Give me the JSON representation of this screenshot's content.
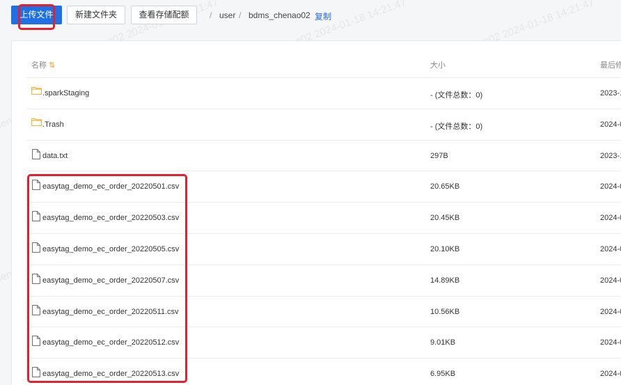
{
  "toolbar": {
    "upload_label": "上传文件",
    "new_folder_label": "新建文件夹",
    "quota_label": "查看存储配额"
  },
  "breadcrumb": {
    "sep": "/",
    "items": [
      "user",
      "bdms_chenao02"
    ],
    "copy_label": "复制"
  },
  "table": {
    "headers": {
      "name": "名称",
      "size": "大小",
      "modified": "最后修"
    },
    "rows": [
      {
        "type": "folder",
        "name": ".sparkStaging",
        "size": "- (文件总数：0)",
        "date": "2023-1"
      },
      {
        "type": "folder",
        "name": ".Trash",
        "size": "- (文件总数：0)",
        "date": "2024-0"
      },
      {
        "type": "file",
        "name": "data.txt",
        "size": "297B",
        "date": "2023-1"
      },
      {
        "type": "file",
        "name": "easytag_demo_ec_order_20220501.csv",
        "size": "20.65KB",
        "date": "2024-0"
      },
      {
        "type": "file",
        "name": "easytag_demo_ec_order_20220503.csv",
        "size": "20.45KB",
        "date": "2024-0"
      },
      {
        "type": "file",
        "name": "easytag_demo_ec_order_20220505.csv",
        "size": "20.10KB",
        "date": "2024-0"
      },
      {
        "type": "file",
        "name": "easytag_demo_ec_order_20220507.csv",
        "size": "14.89KB",
        "date": "2024-0"
      },
      {
        "type": "file",
        "name": "easytag_demo_ec_order_20220511.csv",
        "size": "10.56KB",
        "date": "2024-0"
      },
      {
        "type": "file",
        "name": "easytag_demo_ec_order_20220512.csv",
        "size": "9.01KB",
        "date": "2024-0"
      },
      {
        "type": "file",
        "name": "easytag_demo_ec_order_20220513.csv",
        "size": "6.95KB",
        "date": "2024-0"
      }
    ]
  },
  "watermark": {
    "text": "chenao02 2024-01-18 14:21:47"
  },
  "colors": {
    "primary": "#1f6fe5",
    "highlight": "#e5202e",
    "folder": "#f3b23b"
  }
}
